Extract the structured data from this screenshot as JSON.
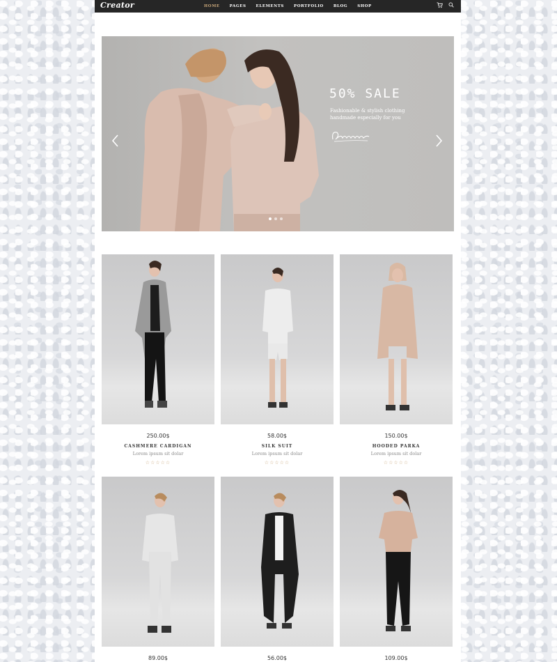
{
  "nav": {
    "logo": "Creator",
    "items": [
      {
        "label": "HOME",
        "active": true
      },
      {
        "label": "PAGES",
        "active": false
      },
      {
        "label": "ELEMENTS",
        "active": false
      },
      {
        "label": "PORTFOLIO",
        "active": false
      },
      {
        "label": "BLOG",
        "active": false
      },
      {
        "label": "SHOP",
        "active": false
      }
    ],
    "icons": [
      "cart-icon",
      "search-icon"
    ]
  },
  "hero": {
    "title": "50% SALE",
    "subtitle_line1": "Fashionable & stylish clothing",
    "subtitle_line2": "handmade especially for you",
    "slides": 3,
    "active_slide": 1
  },
  "products": [
    {
      "price": "250.00$",
      "name": "CASHMERE CARDIGAN",
      "desc": "Lorem ipsum sit dolar",
      "rating": "☆☆☆☆☆"
    },
    {
      "price": "58.00$",
      "name": "SILK SUIT",
      "desc": "Lorem ipsum sit dolar",
      "rating": "☆☆☆☆☆"
    },
    {
      "price": "150.00$",
      "name": "HOODED PARKA",
      "desc": "Lorem ipsum sit dolar",
      "rating": "☆☆☆☆☆"
    },
    {
      "price": "89.00$",
      "name": "",
      "desc": "",
      "rating": ""
    },
    {
      "price": "56.00$",
      "name": "",
      "desc": "",
      "rating": ""
    },
    {
      "price": "109.00$",
      "name": "",
      "desc": "",
      "rating": ""
    }
  ],
  "colors": {
    "nav_bg": "#262626",
    "accent": "#c9a77a",
    "page_bg": "#ffffff"
  }
}
